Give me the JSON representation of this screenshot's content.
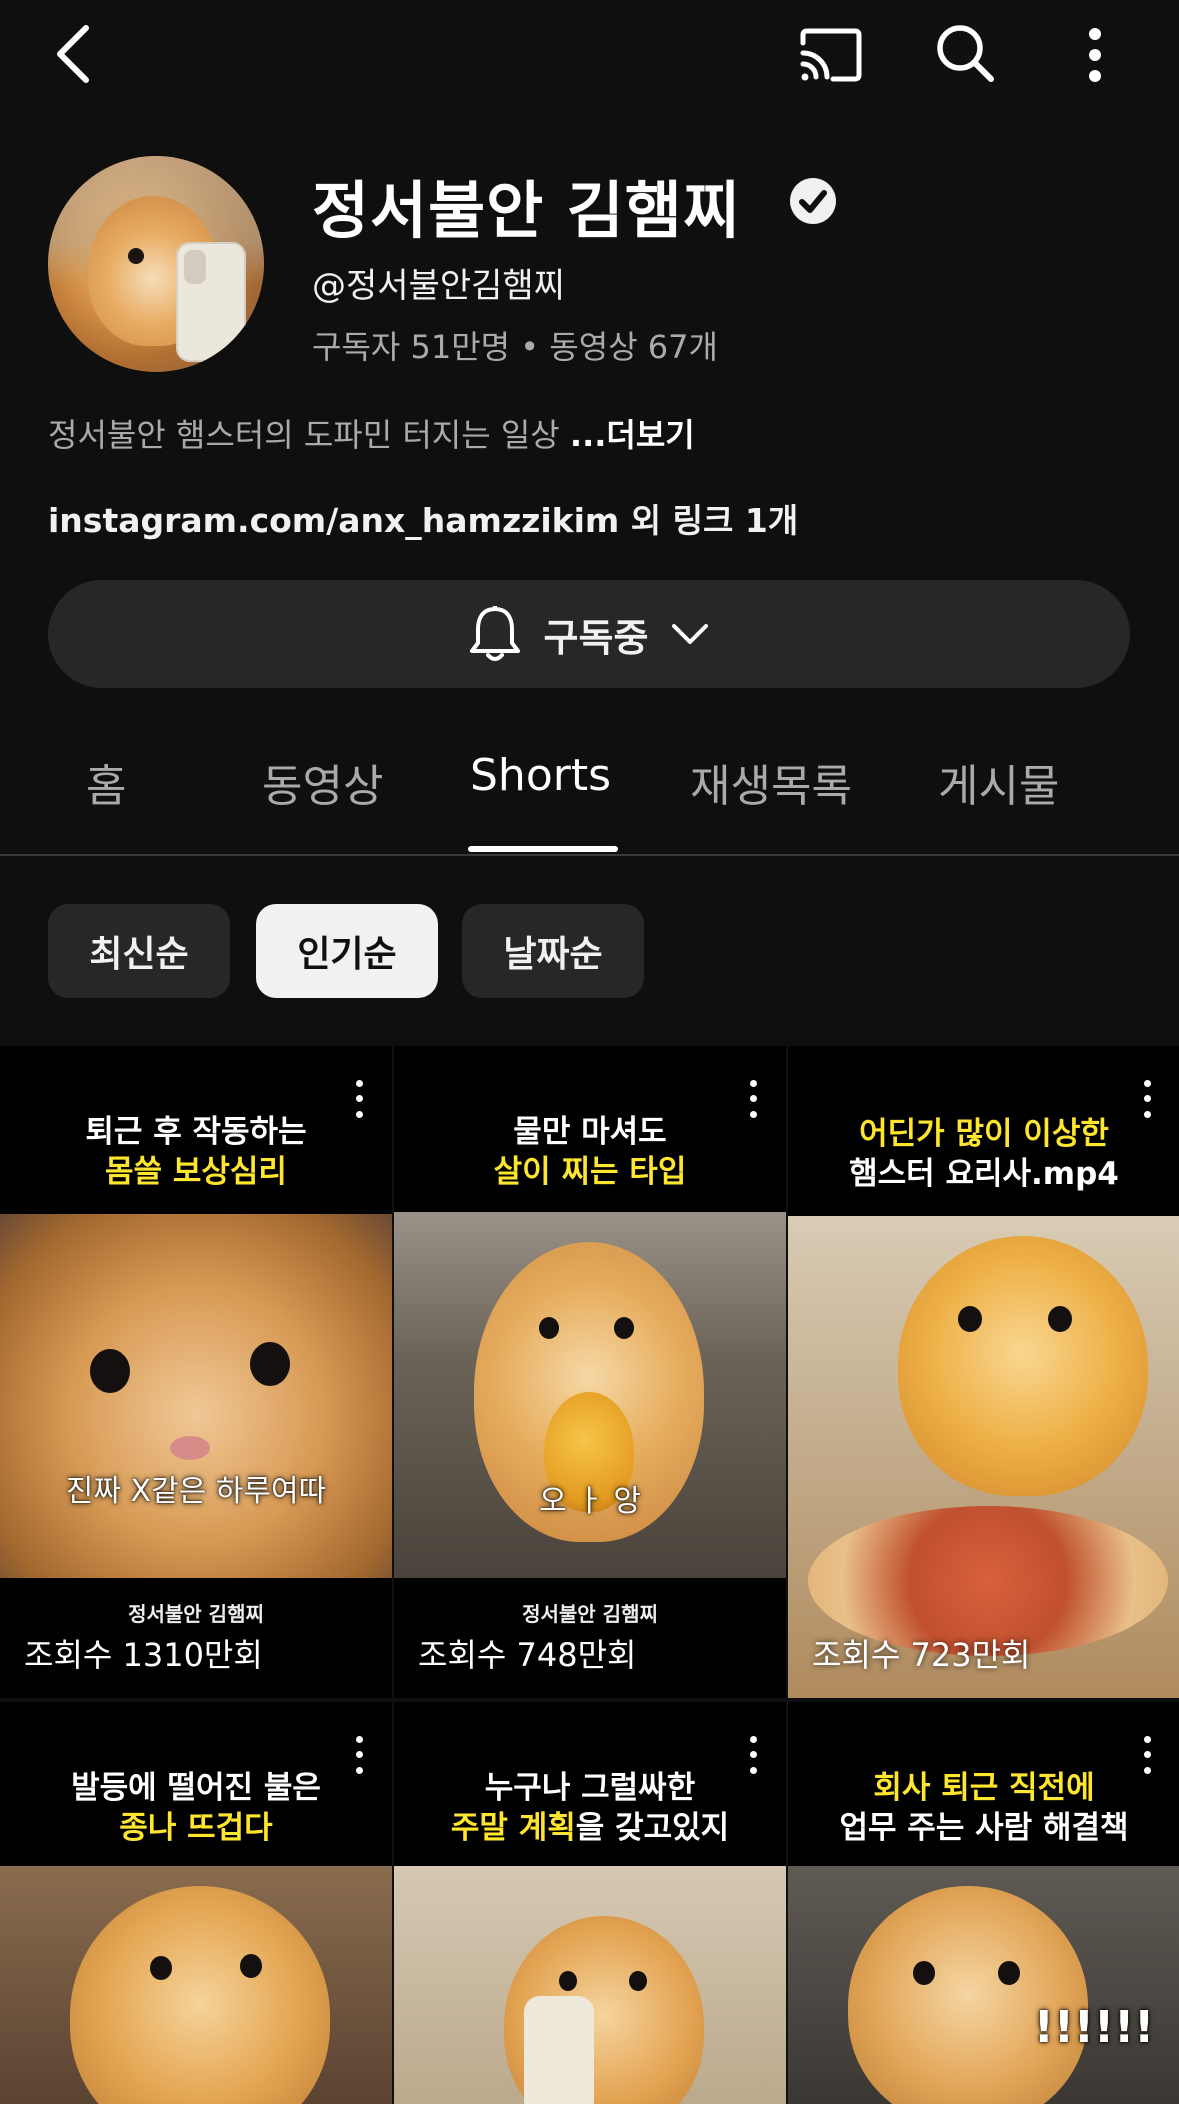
{
  "topbar": {
    "back_icon": "chevron-left-icon",
    "cast_icon": "cast-icon",
    "search_icon": "search-icon",
    "more_icon": "more-vertical-icon"
  },
  "channel": {
    "name": "정서불안 김햄찌",
    "handle": "@정서불안김햄찌",
    "stats": "구독자 51만명 • 동영상 67개",
    "description": "정서불안 햄스터의 도파민 터지는 일상",
    "more_label": "...더보기",
    "link": "instagram.com/anx_hamzzikim 외 링크 1개",
    "subscribe_label": "구독중"
  },
  "tabs": [
    {
      "label": "홈"
    },
    {
      "label": "동영상"
    },
    {
      "label": "Shorts"
    },
    {
      "label": "재생목록"
    },
    {
      "label": "게시물"
    }
  ],
  "active_tab": "Shorts",
  "chips": [
    {
      "label": "최신순"
    },
    {
      "label": "인기순"
    },
    {
      "label": "날짜순"
    }
  ],
  "active_chip": "인기순",
  "shorts": [
    {
      "line1": "퇴근 후 작동하는",
      "line2": "몸쓸 보상심리",
      "overlay": "진짜 X같은 하루여따",
      "brand": "정서불안 김햄찌",
      "views": "조회수 1310만회"
    },
    {
      "line1": "물만 마셔도",
      "line2": "살이 찌는 타입",
      "overlay": "오 ㅏ 앙",
      "brand": "정서불안 김햄찌",
      "views": "조회수 748만회"
    },
    {
      "line1": "어딘가 많이 이상한",
      "line2": "햄스터 요리사.mp4",
      "views": "조회수 723만회"
    },
    {
      "line1": "발등에 떨어진 불은",
      "line2": "종나 뜨겁다"
    },
    {
      "line1": "누구나 그럴싸한",
      "line2a": "주말 계획",
      "line2b": "을 갖고있지"
    },
    {
      "line1": "회사 퇴근 직전에",
      "line2": "업무 주는 사람 해결책",
      "overlay": "!!!!!!"
    }
  ],
  "colors": {
    "background": "#0f0f0f",
    "chip_bg": "#272727",
    "caption_yellow": "#ffe62e"
  }
}
